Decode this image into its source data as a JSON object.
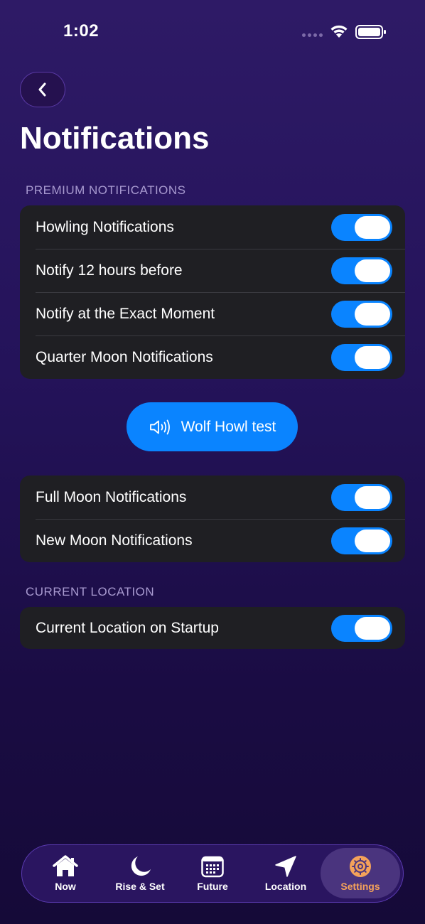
{
  "status_bar": {
    "time": "1:02"
  },
  "header": {
    "title": "Notifications"
  },
  "sections": {
    "premium": {
      "header": "PREMIUM NOTIFICATIONS",
      "rows": [
        {
          "label": "Howling Notifications",
          "on": true
        },
        {
          "label": "Notify 12 hours before",
          "on": true
        },
        {
          "label": "Notify at the Exact Moment",
          "on": true
        },
        {
          "label": "Quarter Moon Notifications",
          "on": true
        }
      ]
    },
    "test_button_label": "Wolf Howl test",
    "moons": {
      "rows": [
        {
          "label": "Full Moon Notifications",
          "on": true
        },
        {
          "label": "New Moon Notifications",
          "on": true
        }
      ]
    },
    "location": {
      "header": "CURRENT LOCATION",
      "rows": [
        {
          "label": "Current Location on Startup",
          "on": true
        }
      ]
    }
  },
  "tab_bar": {
    "tabs": [
      {
        "label": "Now",
        "icon": "house-icon"
      },
      {
        "label": "Rise & Set",
        "icon": "moon-icon"
      },
      {
        "label": "Future",
        "icon": "calendar-icon"
      },
      {
        "label": "Location",
        "icon": "location-arrow-icon"
      },
      {
        "label": "Settings",
        "icon": "gear-icon",
        "active": true
      }
    ]
  },
  "colors": {
    "accent": "#0a84ff",
    "active_tab": "#f4a25a",
    "section_header": "#a89ad0"
  }
}
